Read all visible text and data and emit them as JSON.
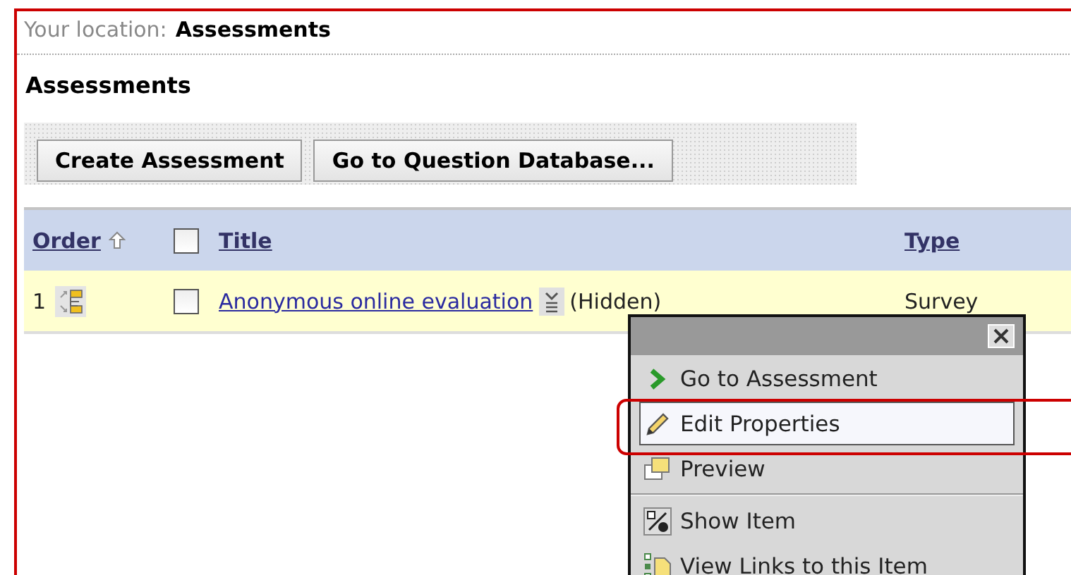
{
  "breadcrumb": {
    "label": "Your location:",
    "current": "Assessments"
  },
  "page_title": "Assessments",
  "buttons": [
    "Create Assessment",
    "Go to Question Database..."
  ],
  "table": {
    "columns": {
      "order": "Order",
      "title": "Title",
      "type": "Type"
    },
    "order_sorted_ascending": true,
    "select_all_checked": false,
    "rows": [
      {
        "order": "1",
        "checked": false,
        "title": "Anonymous online evaluation",
        "status": "(Hidden)",
        "type": "Survey"
      }
    ]
  },
  "context_menu": {
    "groups": [
      [
        {
          "label": "Go to Assessment",
          "kind": "go",
          "selected": false
        },
        {
          "label": "Edit Properties",
          "kind": "edit",
          "selected": true
        },
        {
          "label": "Preview",
          "kind": "preview",
          "selected": false
        }
      ],
      [
        {
          "label": "Show Item",
          "kind": "show",
          "selected": false
        },
        {
          "label": "View Links to this Item",
          "kind": "links",
          "selected": false
        }
      ]
    ]
  },
  "annotation": {
    "highlight_selected_item": true
  }
}
